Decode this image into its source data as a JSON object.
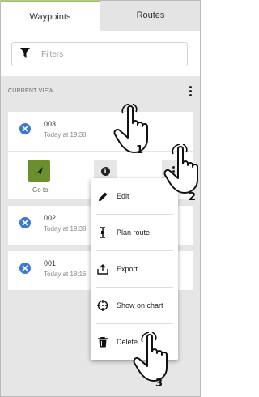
{
  "tabs": [
    {
      "label": "Waypoints",
      "active": true
    },
    {
      "label": "Routes",
      "active": false
    }
  ],
  "filters": {
    "label": "Filters"
  },
  "section": {
    "title": "CURRENT VIEW"
  },
  "waypoints": [
    {
      "name": "003",
      "time": "Today at 19:38"
    },
    {
      "name": "002",
      "time": "Today at 19:38"
    },
    {
      "name": "001",
      "time": "Today at 18:16"
    }
  ],
  "actions": {
    "goto_label": "Go to"
  },
  "menu": {
    "items": [
      {
        "label": "Edit",
        "icon": "pencil-icon"
      },
      {
        "label": "Plan route",
        "icon": "route-icon"
      },
      {
        "label": "Export",
        "icon": "export-icon"
      },
      {
        "label": "Show on chart",
        "icon": "crosshair-icon"
      },
      {
        "label": "Delete",
        "icon": "trash-icon"
      }
    ]
  },
  "annotations": {
    "step1": "1",
    "step2": "2",
    "step3": "3"
  },
  "colors": {
    "accent": "#9acd32",
    "goto": "#6a8f2c",
    "remove": "#3a78d6",
    "background": "#e6e6e6"
  }
}
